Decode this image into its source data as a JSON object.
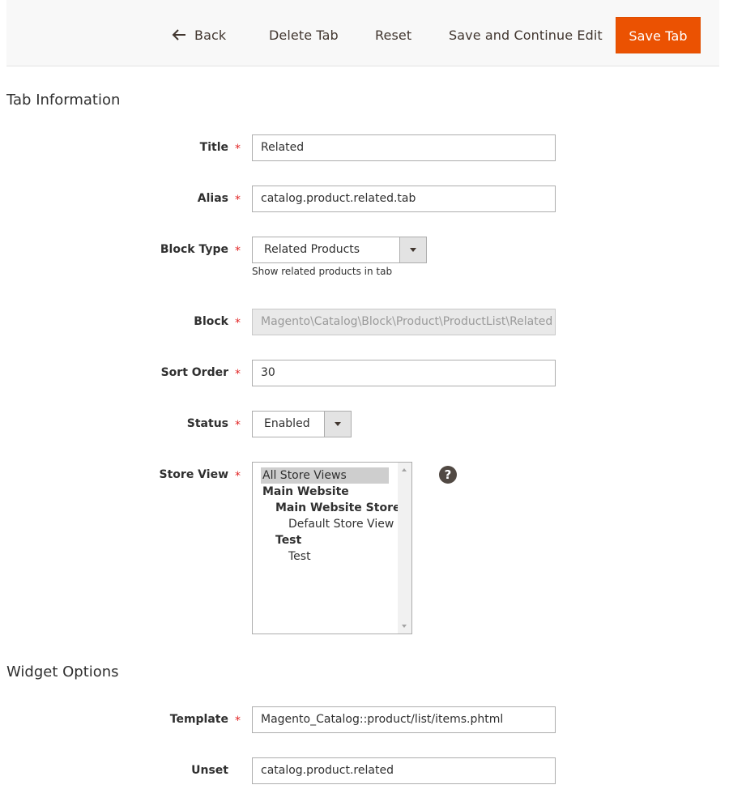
{
  "toolbar": {
    "back_label": "Back",
    "delete_label": "Delete Tab",
    "reset_label": "Reset",
    "save_continue_label": "Save and Continue Edit",
    "save_label": "Save Tab",
    "save_color": "#eb5202"
  },
  "tab_information": {
    "heading": "Tab Information",
    "required_mark": "*",
    "title": {
      "label": "Title",
      "value": "Related"
    },
    "alias": {
      "label": "Alias",
      "value": "catalog.product.related.tab"
    },
    "block_type": {
      "label": "Block Type",
      "value": "Related Products",
      "note": "Show related products in tab"
    },
    "block": {
      "label": "Block",
      "value": "Magento\\Catalog\\Block\\Product\\ProductList\\Related"
    },
    "sort_order": {
      "label": "Sort Order",
      "value": "30"
    },
    "status": {
      "label": "Status",
      "value": "Enabled"
    },
    "store_view": {
      "label": "Store View",
      "help_icon": "question-icon",
      "options": [
        {
          "text": "All Store Views",
          "level": 0,
          "bold": false,
          "selected": true
        },
        {
          "text": "Main Website",
          "level": 0,
          "bold": true,
          "selected": false
        },
        {
          "text": "Main Website Store",
          "level": 1,
          "bold": true,
          "selected": false
        },
        {
          "text": "Default Store View",
          "level": 2,
          "bold": false,
          "selected": false
        },
        {
          "text": "Test",
          "level": 1,
          "bold": true,
          "selected": false
        },
        {
          "text": "Test",
          "level": 2,
          "bold": false,
          "selected": false
        }
      ]
    }
  },
  "widget_options": {
    "heading": "Widget Options",
    "template": {
      "label": "Template",
      "value": "Magento_Catalog::product/list/items.phtml"
    },
    "unset": {
      "label": "Unset",
      "value": "catalog.product.related"
    }
  }
}
